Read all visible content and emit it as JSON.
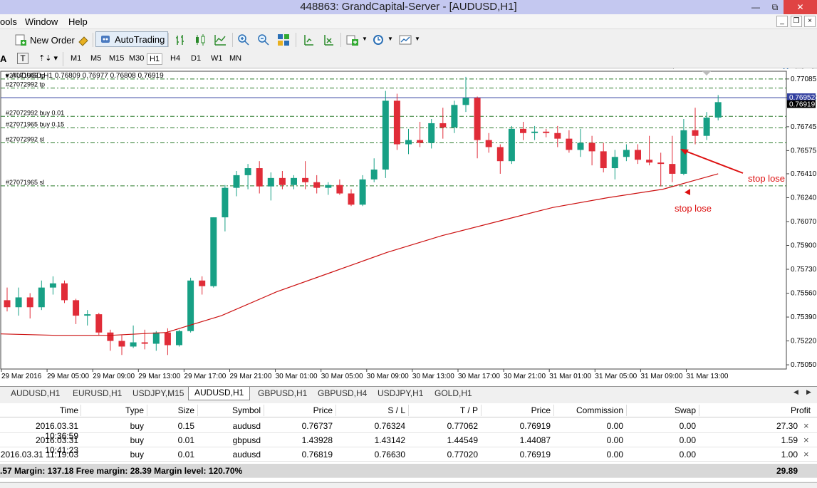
{
  "window": {
    "title": "448863: GrandCapital-Server - [AUDUSD,H1]",
    "minimize": "—",
    "restore": "⧉",
    "close": "✕"
  },
  "menu": {
    "items": [
      "ools",
      "Window",
      "Help"
    ]
  },
  "toolbar": {
    "new_order": "New Order",
    "autotrading": "AutoTrading"
  },
  "timeframes": [
    "M1",
    "M5",
    "M15",
    "M30",
    "H1",
    "H4",
    "D1",
    "W1",
    "MN"
  ],
  "active_timeframe": "H1",
  "chart_data": {
    "type": "candlestick",
    "header": "AUDUSD,H1  0.76809 0.76977 0.76808 0.76919",
    "ylim": [
      0.7502,
      0.7714
    ],
    "y_ticks": [
      "0.77085",
      "0.76952",
      "0.76745",
      "0.76575",
      "0.76410",
      "0.76240",
      "0.76070",
      "0.75900",
      "0.75730",
      "0.75560",
      "0.75390",
      "0.75220",
      "0.75050"
    ],
    "current_price": "0.76919",
    "ask_price": "0.76952",
    "x_ticks": [
      "29 Mar 2016",
      "29 Mar 05:00",
      "29 Mar 09:00",
      "29 Mar 13:00",
      "29 Mar 17:00",
      "29 Mar 21:00",
      "30 Mar 01:00",
      "30 Mar 05:00",
      "30 Mar 09:00",
      "30 Mar 13:00",
      "30 Mar 17:00",
      "30 Mar 21:00",
      "31 Mar 01:00",
      "31 Mar 05:00",
      "31 Mar 09:00",
      "31 Mar 13:00"
    ],
    "candles": [
      [
        0.7551,
        0.756,
        0.7543,
        0.7546
      ],
      [
        0.7546,
        0.756,
        0.754,
        0.7553
      ],
      [
        0.7553,
        0.7556,
        0.7538,
        0.7546
      ],
      [
        0.7546,
        0.7565,
        0.7544,
        0.756
      ],
      [
        0.756,
        0.7568,
        0.7555,
        0.7563
      ],
      [
        0.7563,
        0.7565,
        0.7549,
        0.7551
      ],
      [
        0.7551,
        0.7552,
        0.7534,
        0.754
      ],
      [
        0.754,
        0.7544,
        0.7533,
        0.7541
      ],
      [
        0.7541,
        0.7542,
        0.7526,
        0.7528
      ],
      [
        0.7528,
        0.753,
        0.7515,
        0.7522
      ],
      [
        0.7522,
        0.7526,
        0.7512,
        0.7518
      ],
      [
        0.7518,
        0.7533,
        0.7517,
        0.7521
      ],
      [
        0.7521,
        0.753,
        0.7516,
        0.752
      ],
      [
        0.752,
        0.7529,
        0.7515,
        0.7528
      ],
      [
        0.7528,
        0.7531,
        0.7512,
        0.7519
      ],
      [
        0.7519,
        0.753,
        0.7518,
        0.7529
      ],
      [
        0.7529,
        0.7567,
        0.7528,
        0.7565
      ],
      [
        0.7565,
        0.7568,
        0.7555,
        0.7561
      ],
      [
        0.7561,
        0.761,
        0.756,
        0.761
      ],
      [
        0.761,
        0.7633,
        0.76,
        0.7631
      ],
      [
        0.7631,
        0.7643,
        0.7625,
        0.764
      ],
      [
        0.764,
        0.7648,
        0.763,
        0.7645
      ],
      [
        0.7645,
        0.765,
        0.7627,
        0.7632
      ],
      [
        0.7632,
        0.7642,
        0.7622,
        0.7638
      ],
      [
        0.7638,
        0.7643,
        0.763,
        0.7633
      ],
      [
        0.7633,
        0.764,
        0.763,
        0.7638
      ],
      [
        0.7638,
        0.765,
        0.763,
        0.7635
      ],
      [
        0.7635,
        0.764,
        0.7627,
        0.7631
      ],
      [
        0.7631,
        0.7635,
        0.7626,
        0.7633
      ],
      [
        0.7633,
        0.7637,
        0.7626,
        0.7627
      ],
      [
        0.7627,
        0.763,
        0.7618,
        0.7619
      ],
      [
        0.7619,
        0.764,
        0.7618,
        0.7637
      ],
      [
        0.7637,
        0.7652,
        0.7635,
        0.7644
      ],
      [
        0.7644,
        0.77,
        0.7638,
        0.7693
      ],
      [
        0.7693,
        0.7698,
        0.7658,
        0.7662
      ],
      [
        0.7662,
        0.7673,
        0.7655,
        0.7665
      ],
      [
        0.7665,
        0.7678,
        0.766,
        0.7663
      ],
      [
        0.7663,
        0.768,
        0.7659,
        0.7677
      ],
      [
        0.7677,
        0.7688,
        0.7666,
        0.7674
      ],
      [
        0.7674,
        0.7693,
        0.767,
        0.769
      ],
      [
        0.769,
        0.771,
        0.7685,
        0.7695
      ],
      [
        0.7695,
        0.7696,
        0.7652,
        0.7665
      ],
      [
        0.7665,
        0.767,
        0.7656,
        0.766
      ],
      [
        0.766,
        0.7662,
        0.7641,
        0.765
      ],
      [
        0.765,
        0.7675,
        0.7648,
        0.7673
      ],
      [
        0.7673,
        0.7678,
        0.7665,
        0.767
      ],
      [
        0.767,
        0.7675,
        0.7665,
        0.7671
      ],
      [
        0.7671,
        0.7673,
        0.7667,
        0.767
      ],
      [
        0.767,
        0.7675,
        0.766,
        0.7666
      ],
      [
        0.7666,
        0.7672,
        0.7656,
        0.7658
      ],
      [
        0.7658,
        0.7673,
        0.7653,
        0.7663
      ],
      [
        0.7663,
        0.7668,
        0.7647,
        0.7657
      ],
      [
        0.7657,
        0.7663,
        0.7642,
        0.7645
      ],
      [
        0.7645,
        0.7658,
        0.7637,
        0.7653
      ],
      [
        0.7653,
        0.7662,
        0.765,
        0.7658
      ],
      [
        0.7658,
        0.7662,
        0.7648,
        0.7651
      ],
      [
        0.7651,
        0.7668,
        0.7647,
        0.7649
      ],
      [
        0.7649,
        0.7656,
        0.7632,
        0.7648
      ],
      [
        0.7648,
        0.7668,
        0.7635,
        0.7641
      ],
      [
        0.7641,
        0.768,
        0.764,
        0.7672
      ],
      [
        0.7672,
        0.7688,
        0.7662,
        0.7668
      ],
      [
        0.7668,
        0.7685,
        0.7665,
        0.7681
      ],
      [
        0.7681,
        0.7697,
        0.7679,
        0.7692
      ]
    ],
    "ma_line": [
      0.7527,
      0.7526,
      0.7526,
      0.7528,
      0.754,
      0.7557,
      0.7571,
      0.7585,
      0.7597,
      0.7607,
      0.7617,
      0.7624,
      0.763,
      0.7641
    ],
    "levels": [
      {
        "label": "#27071965 tp",
        "price": 0.77085,
        "color": "#2a7a2a"
      },
      {
        "label": "#27072992 tp",
        "price": 0.7702,
        "color": "#2a7a2a"
      },
      {
        "label": "#27072992 buy 0.01",
        "price": 0.76819,
        "color": "#2a7a2a"
      },
      {
        "label": "#27071965 buy 0.15",
        "price": 0.76737,
        "color": "#2a7a2a"
      },
      {
        "label": "#27072992 sl",
        "price": 0.7663,
        "color": "#2a7a2a"
      },
      {
        "label": "#27071965 sl",
        "price": 0.76324,
        "color": "#2a7a2a"
      }
    ],
    "annotations": [
      "stop lose",
      "stop lose"
    ],
    "colors": {
      "bull": "#17a085",
      "bear": "#e02c38",
      "ma": "#cc1111",
      "level": "#2a7a2a",
      "ask": "#3340a0",
      "annotation": "#dd1111"
    }
  },
  "chart_tabs": [
    "AUDUSD,H1",
    "EURUSD,H1",
    "USDJPY,M15",
    "AUDUSD,H1",
    "GBPUSD,H1",
    "GBPUSD,H4",
    "USDJPY,H1",
    "GOLD,H1"
  ],
  "active_chart_tab": 3,
  "orders": {
    "headers": [
      "Time",
      "Type",
      "Size",
      "Symbol",
      "Price",
      "S / L",
      "T / P",
      "Price",
      "Commission",
      "Swap",
      "Profit"
    ],
    "rows": [
      [
        "2016.03.31 10:36:59",
        "buy",
        "0.15",
        "audusd",
        "0.76737",
        "0.76324",
        "0.77062",
        "0.76919",
        "0.00",
        "0.00",
        "27.30"
      ],
      [
        "2016.03.31 10:41:23",
        "buy",
        "0.01",
        "gbpusd",
        "1.43928",
        "1.43142",
        "1.44549",
        "1.44087",
        "0.00",
        "0.00",
        "1.59"
      ],
      [
        "2016.03.31 11:19:03",
        "buy",
        "0.01",
        "audusd",
        "0.76819",
        "0.76630",
        "0.77020",
        "0.76919",
        "0.00",
        "0.00",
        "1.00"
      ]
    ],
    "close_icon": "×",
    "summary": ".57  Margin: 137.18  Free margin: 28.39  Margin level: 120.70%",
    "summary_total": "29.89"
  }
}
